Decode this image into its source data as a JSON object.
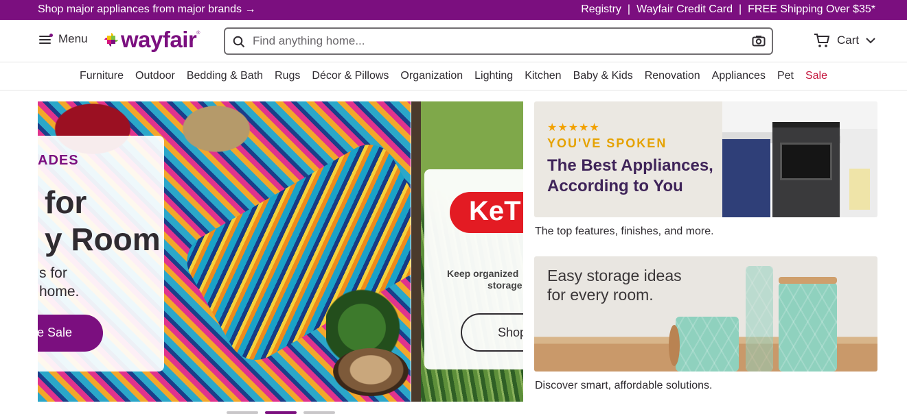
{
  "promo_bar": {
    "left_text": "Shop major appliances from major brands →",
    "links": [
      "Registry",
      "Wayfair Credit Card",
      "FREE Shipping Over $35*"
    ]
  },
  "header": {
    "menu_label": "Menu",
    "logo_text": "wayfair",
    "search_placeholder": "Find anything home...",
    "cart_label": "Cart"
  },
  "nav": {
    "items": [
      "Furniture",
      "Outdoor",
      "Bedding & Bath",
      "Rugs",
      "Décor & Pillows",
      "Organization",
      "Lighting",
      "Kitchen",
      "Baby & Kids",
      "Renovation",
      "Appliances",
      "Pet",
      "Sale"
    ]
  },
  "hero": {
    "slide1": {
      "kicker": "ADES",
      "headline_line1": "for",
      "headline_line2": "y Room",
      "sub_line1": "s for",
      "sub_line2": "home.",
      "button": "e Sale"
    },
    "slide2": {
      "brand_badge": "KeT",
      "text_line1": "Keep organized",
      "text_line2": "storage",
      "button": "Shop"
    },
    "dots": 3,
    "active_dot": 2
  },
  "promos": [
    {
      "stars": "★★★★★",
      "kicker": "YOU'VE SPOKEN",
      "title_line1": "The Best Appliances,",
      "title_line2": "According to You",
      "caption": "The top features, finishes, and more."
    },
    {
      "title_line1": "Easy storage ideas",
      "title_line2": "for every room.",
      "caption": "Discover smart, affordable solutions."
    }
  ],
  "colors": {
    "brand_purple": "#7b0f7f",
    "sale_red": "#c4133a"
  }
}
